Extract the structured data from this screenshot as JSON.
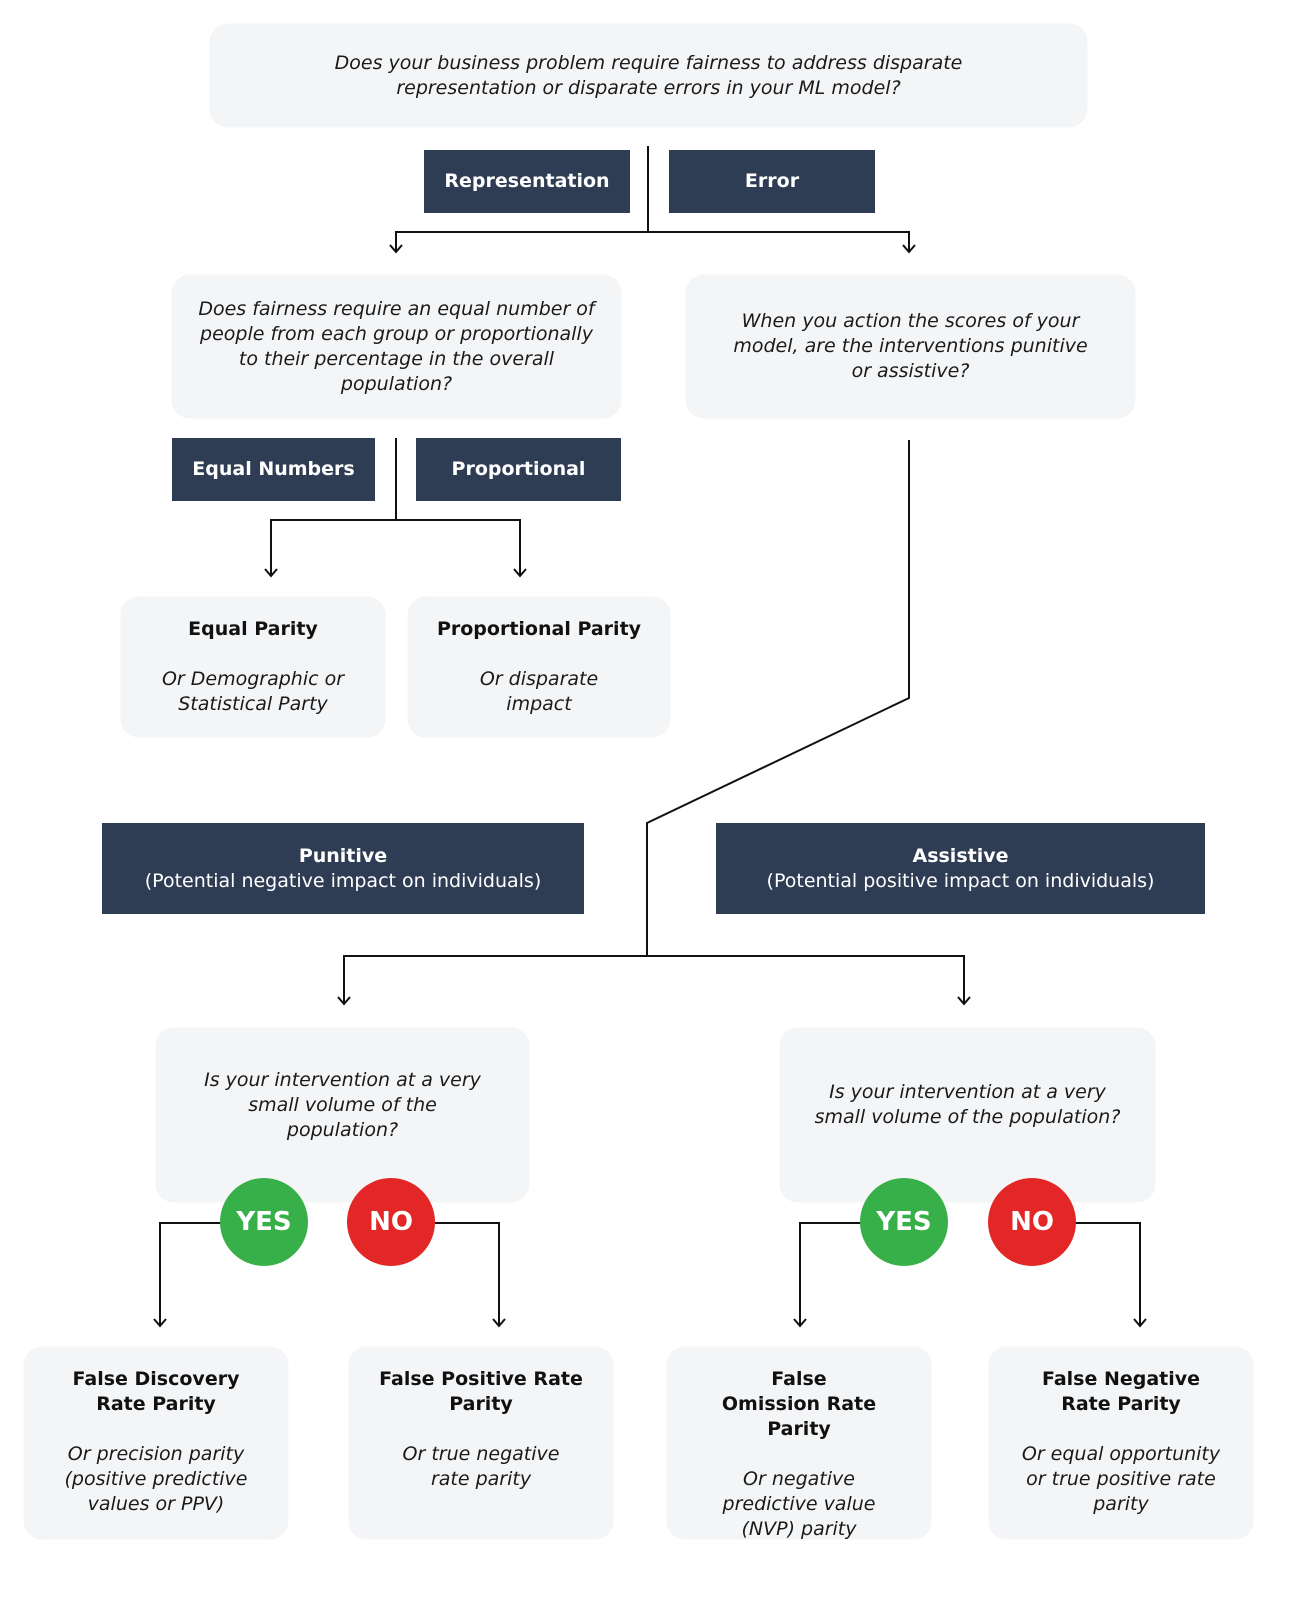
{
  "top_question": {
    "line1": "Does your business problem require fairness to address disparate",
    "line2": "representation or disparate errors in your ML model?"
  },
  "branch1": {
    "left_label": "Representation",
    "right_label": "Error"
  },
  "representation_question": "Does fairness require an equal number of people from each group or proportionally to their percentage in the overall population?",
  "error_question": "When you action the scores of your model, are the interventions punitive or assistive?",
  "branch2": {
    "left_label": "Equal Numbers",
    "right_label": "Proportional"
  },
  "representation_results": [
    {
      "title": "Equal Parity",
      "desc": "Or Demographic or Statistical Party"
    },
    {
      "title": "Proportional Parity",
      "desc": "Or disparate impact"
    }
  ],
  "intervention_labels": {
    "punitive": {
      "title": "Punitive",
      "sub": "(Potential negative impact on individuals)"
    },
    "assistive": {
      "title": "Assistive",
      "sub": "(Potential positive impact on individuals)"
    }
  },
  "volume_questions": {
    "punitive": "Is your intervention at a very small volume of the population?",
    "assistive": "Is your intervention at a very small volume of the population?"
  },
  "answers": {
    "yes": "YES",
    "no": "NO"
  },
  "answer_colors": {
    "yes": "#38b04a",
    "no": "#e32626"
  },
  "label_color": "#2f3d54",
  "error_results": [
    {
      "title": "False Discovery Rate Parity",
      "desc": "Or precision parity (positive predictive values or PPV)"
    },
    {
      "title": "False Positive Rate Parity",
      "desc": "Or true negative rate parity"
    },
    {
      "title": "False Omission Rate Parity",
      "desc": "Or negative predictive value (NVP) parity"
    },
    {
      "title": "False Negative Rate Parity",
      "desc": "Or equal opportunity or true positive rate parity"
    }
  ]
}
